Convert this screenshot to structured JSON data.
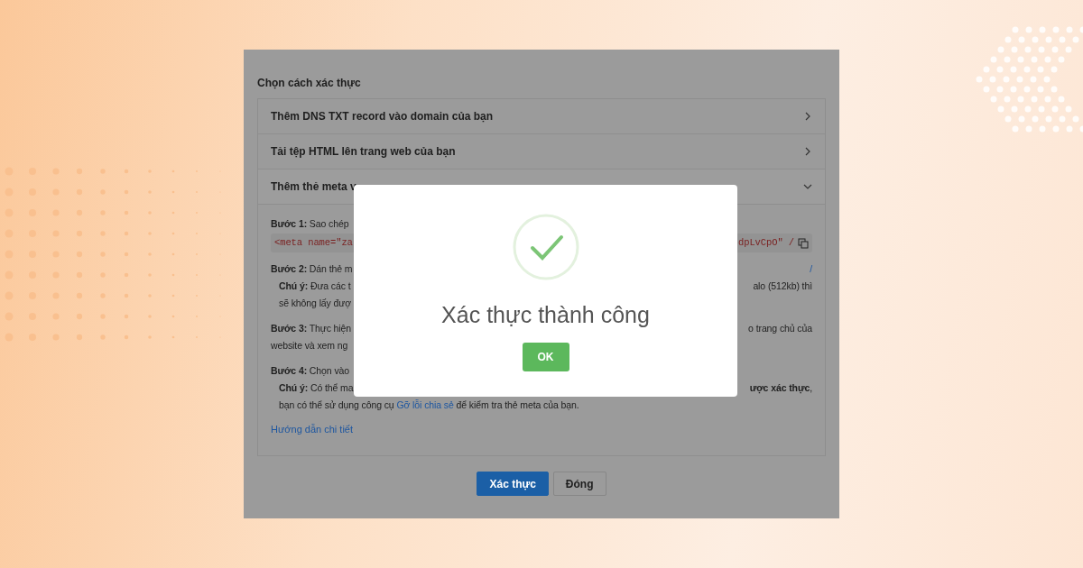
{
  "dialog": {
    "heading": "Chọn cách xác thực",
    "methods": [
      {
        "label": "Thêm DNS TXT record vào domain của bạn",
        "expanded": false
      },
      {
        "label": "Tải tệp HTML lên trang web của bạn",
        "expanded": false
      },
      {
        "label": "Thêm thẻ meta v",
        "expanded": true
      }
    ],
    "steps": [
      {
        "lines": [
          {
            "kind": "text",
            "left": "**Bước 1:** Sao chép"
          },
          {
            "kind": "code",
            "left": "<meta name=\"za",
            "right": "dpLvCpO\" /"
          }
        ]
      },
      {
        "lines": [
          {
            "kind": "text",
            "left": "**Bước 2:** Dán thẻ m",
            "right_link": "/"
          },
          {
            "kind": "note",
            "left": "**Chú ý:** Đưa các t",
            "right": "alo (512kb) thì"
          },
          {
            "kind": "note",
            "left": "sẽ không lấy đượ"
          }
        ]
      },
      {
        "lines": [
          {
            "kind": "text",
            "left": "**Bước 3:** Thực hiện",
            "right": "o trang chủ của"
          },
          {
            "kind": "text",
            "left": "website và xem ng"
          }
        ]
      },
      {
        "lines": [
          {
            "kind": "text",
            "left": "**Bước 4:** Chọn vào"
          },
          {
            "kind": "note",
            "left": "**Chú ý:** Có thể ma",
            "right": "**ược xác thực**,"
          },
          {
            "kind": "link-note",
            "before": "bạn có thể sử dụng công cụ",
            "link": "Gỡ lỗi chia sẻ",
            "after": "để kiểm tra thẻ meta của bạn."
          }
        ]
      }
    ],
    "guide_link": "Hướng dẫn chi tiết",
    "buttons": [
      {
        "label": "Xác thực",
        "kind": "primary"
      },
      {
        "label": "Đóng",
        "kind": "secondary"
      }
    ]
  },
  "popup": {
    "message": "Xác thực thành công",
    "button": "OK"
  }
}
